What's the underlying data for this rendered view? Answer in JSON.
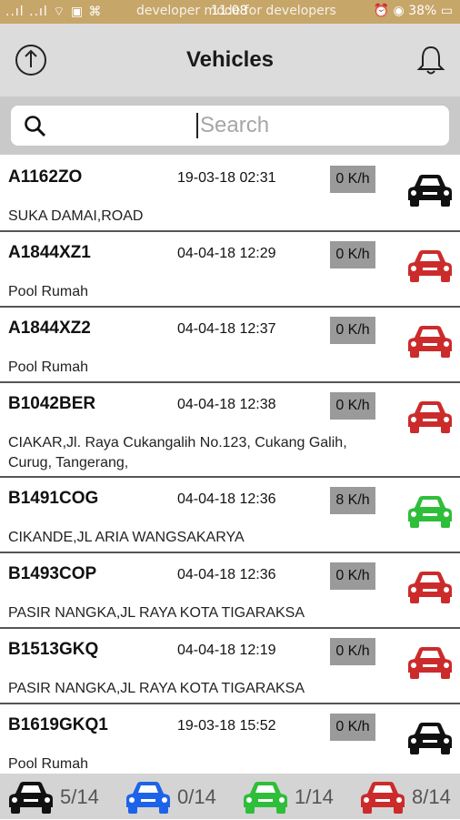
{
  "statusbar": {
    "left_icons": "..ıl ..ıl ⌔ ▣ ⌘",
    "overlay_text": "developer mode    for developers",
    "time": "11:08",
    "battery": "38%"
  },
  "header": {
    "title": "Vehicles",
    "upload_icon": "upload-icon",
    "bell_icon": "bell-icon"
  },
  "search": {
    "placeholder": "Search",
    "icon": "search-icon"
  },
  "colors": {
    "black": "#111111",
    "red": "#cc2b2b",
    "green": "#2fbe3a",
    "blue": "#1d63ea"
  },
  "vehicles": [
    {
      "plate": "A1162ZO",
      "time": "19-03-18 02:31",
      "speed": "0 K/h",
      "address": "SUKA DAMAI,ROAD",
      "status": "black"
    },
    {
      "plate": "A1844XZ1",
      "time": "04-04-18 12:29",
      "speed": "0 K/h",
      "address": "Pool Rumah",
      "status": "red"
    },
    {
      "plate": "A1844XZ2",
      "time": "04-04-18 12:37",
      "speed": "0 K/h",
      "address": "Pool Rumah",
      "status": "red"
    },
    {
      "plate": "B1042BER",
      "time": "04-04-18 12:38",
      "speed": "0 K/h",
      "address": "CIAKAR,Jl. Raya Cukangalih No.123, Cukang Galih, Curug, Tangerang,",
      "status": "red"
    },
    {
      "plate": "B1491COG",
      "time": "04-04-18 12:36",
      "speed": "8 K/h",
      "address": "CIKANDE,JL ARIA WANGSAKARYA",
      "status": "green"
    },
    {
      "plate": "B1493COP",
      "time": "04-04-18 12:36",
      "speed": "0 K/h",
      "address": "PASIR NANGKA,JL RAYA KOTA TIGARAKSA",
      "status": "red"
    },
    {
      "plate": "B1513GKQ",
      "time": "04-04-18 12:19",
      "speed": "0 K/h",
      "address": "PASIR NANGKA,JL RAYA KOTA TIGARAKSA",
      "status": "red"
    },
    {
      "plate": "B1619GKQ1",
      "time": "19-03-18 15:52",
      "speed": "0 K/h",
      "address": "Pool Rumah",
      "status": "black"
    }
  ],
  "summary": [
    {
      "status": "black",
      "count": "5/14"
    },
    {
      "status": "blue",
      "count": "0/14"
    },
    {
      "status": "green",
      "count": "1/14"
    },
    {
      "status": "red",
      "count": "8/14"
    }
  ]
}
